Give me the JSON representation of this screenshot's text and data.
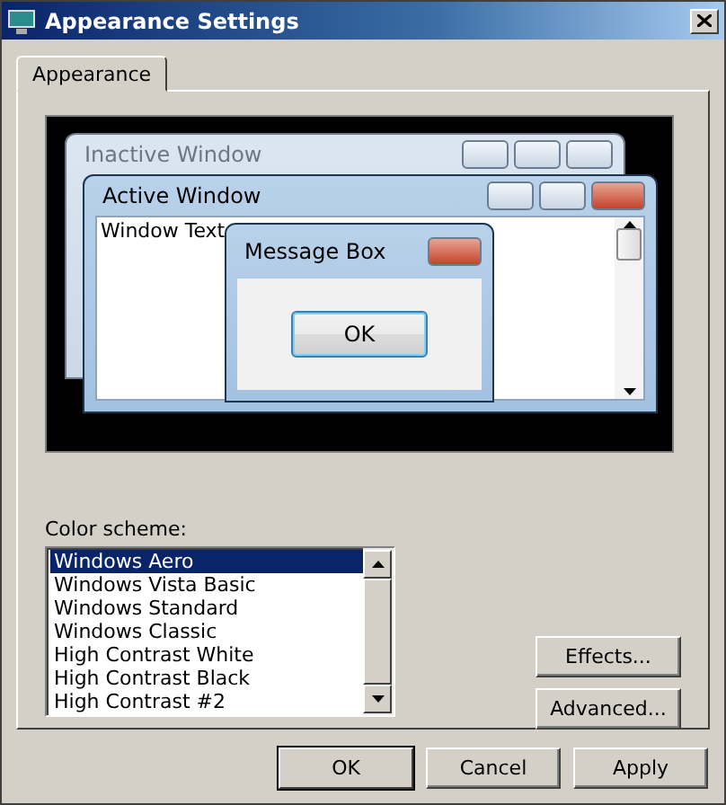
{
  "window": {
    "title": "Appearance Settings"
  },
  "tabs": [
    {
      "label": "Appearance",
      "selected": true
    }
  ],
  "preview": {
    "inactive_window": {
      "title": "Inactive Window"
    },
    "active_window": {
      "title": "Active Window",
      "text": "Window Text"
    },
    "message_box": {
      "title": "Message Box",
      "button": "OK"
    }
  },
  "color_scheme": {
    "label": "Color scheme:",
    "items": [
      {
        "label": "Windows Aero",
        "selected": true
      },
      {
        "label": "Windows Vista Basic",
        "selected": false
      },
      {
        "label": "Windows Standard",
        "selected": false
      },
      {
        "label": "Windows Classic",
        "selected": false
      },
      {
        "label": "High Contrast White",
        "selected": false
      },
      {
        "label": "High Contrast Black",
        "selected": false
      },
      {
        "label": "High Contrast #2",
        "selected": false
      }
    ]
  },
  "side_buttons": [
    "Effects...",
    "Advanced..."
  ],
  "buttons": [
    {
      "label": "OK",
      "default": true
    },
    {
      "label": "Cancel",
      "default": false
    },
    {
      "label": "Apply",
      "default": false
    }
  ]
}
